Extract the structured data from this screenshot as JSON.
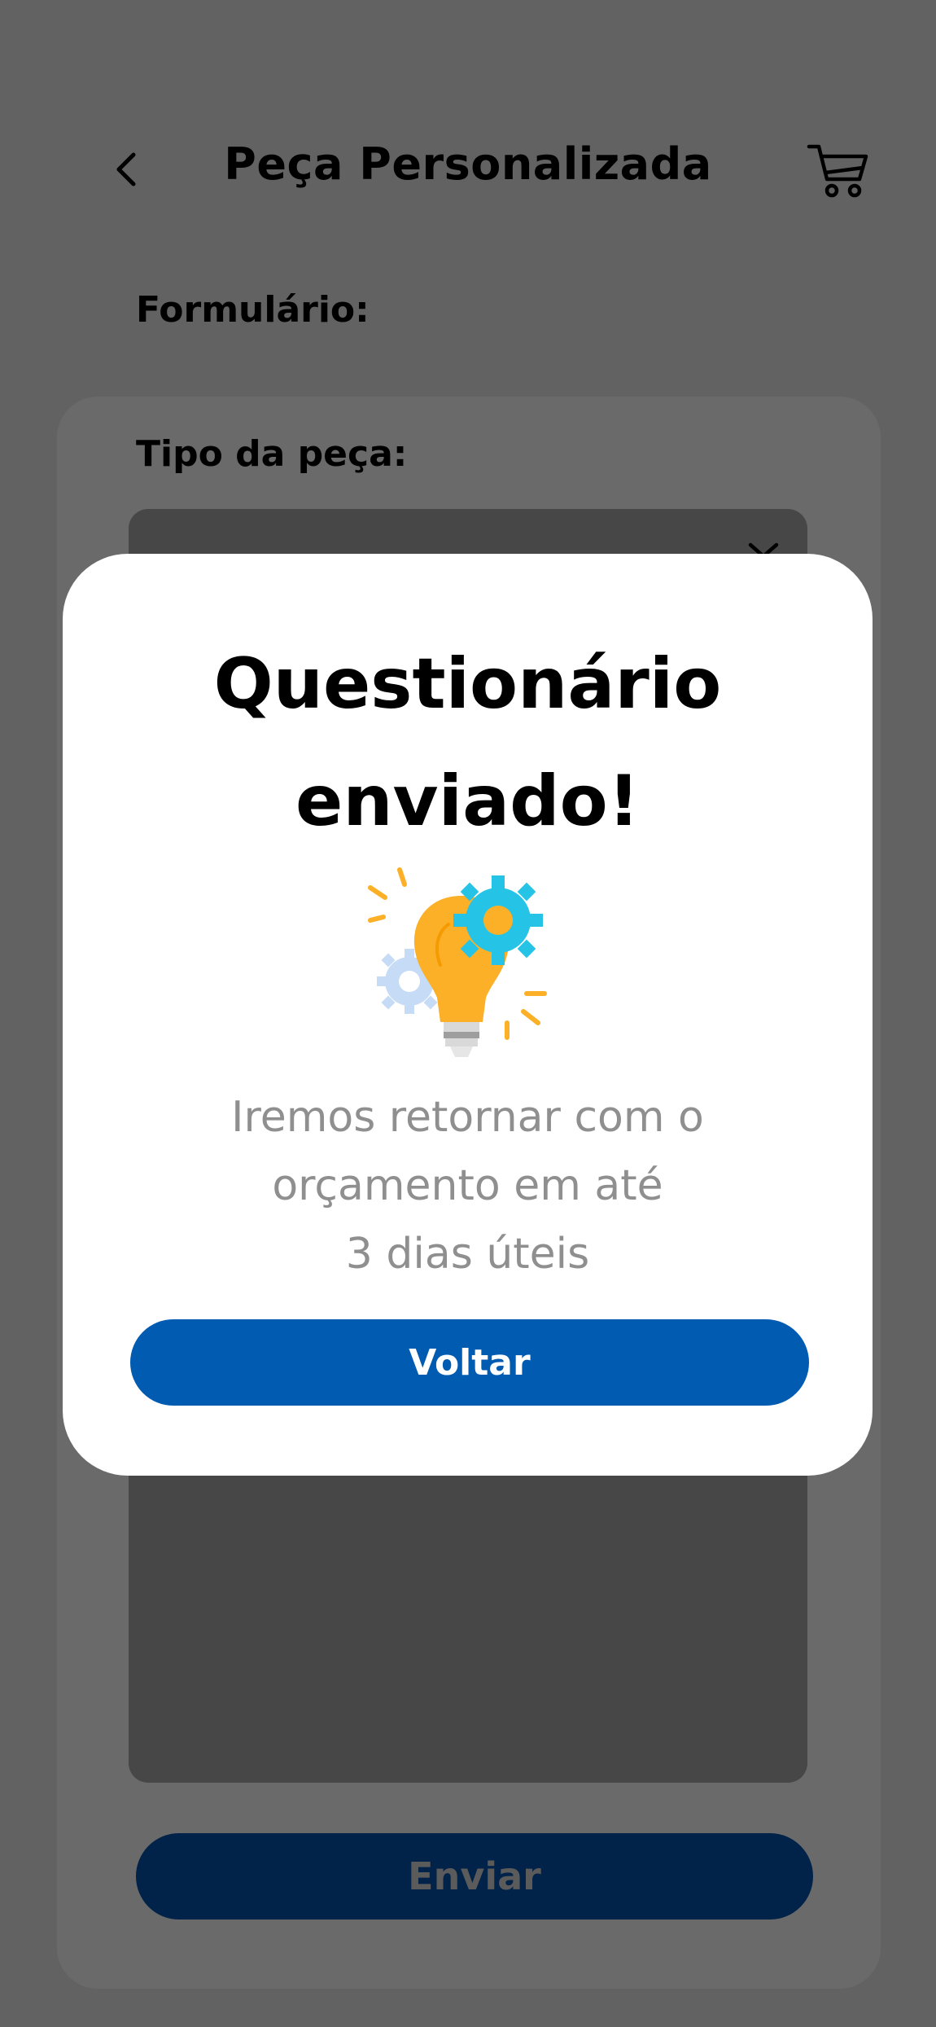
{
  "header": {
    "title": "Peça Personalizada",
    "back_icon": "chevron-left-icon",
    "cart_icon": "shopping-cart-icon"
  },
  "form": {
    "section_label": "Formulário:",
    "piece_type_label": "Tipo da peça:",
    "submit_label": "Enviar"
  },
  "modal": {
    "title_line1": "Questionário",
    "title_line2": "enviado!",
    "illustration_icon": "lightbulb-gears-icon",
    "message_lines": [
      "Iremos retornar com o",
      "orçamento em até",
      "3 dias úteis"
    ],
    "button_label": "Voltar"
  },
  "colors": {
    "overlay": "#626262",
    "primary_button": "#005bb1",
    "submit_button": "#012349",
    "bulb": "#fbb027",
    "gear_blue": "#25c4e6",
    "gear_light": "#c6dbf5"
  }
}
